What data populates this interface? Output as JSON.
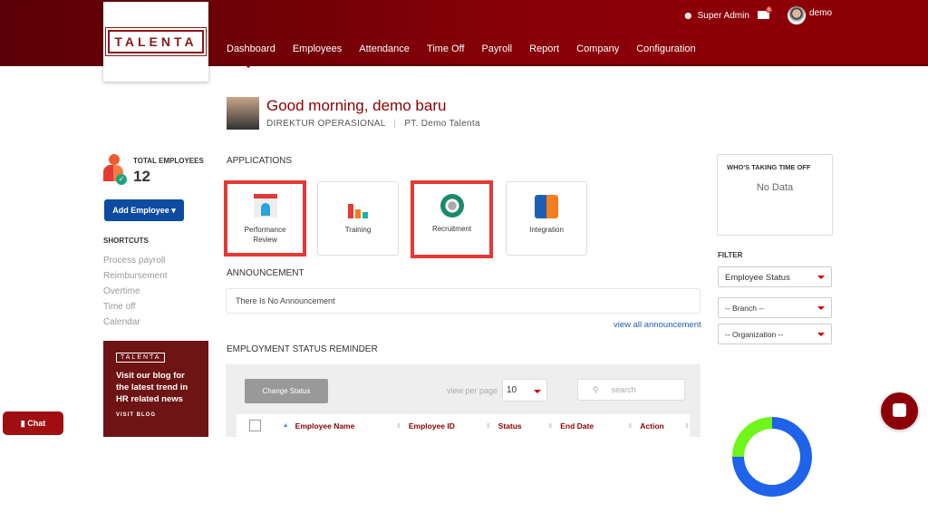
{
  "header": {
    "logo": "TALENTA",
    "nav": [
      "Dashboard",
      "Employees",
      "Attendance",
      "Time Off",
      "Payroll",
      "Report",
      "Company",
      "Configuration"
    ],
    "role": "Super Admin",
    "mail_badge": "6",
    "user": "demo"
  },
  "greeting": {
    "title": "Good morning, demo baru",
    "position": "DIREKTUR OPERASIONAL",
    "company": "PT. Demo Talenta"
  },
  "sidebar": {
    "total_label": "TOTAL EMPLOYEES",
    "total": "12",
    "add_button": "Add Employee",
    "shortcuts_title": "SHORTCUTS",
    "shortcuts": [
      "Process payroll",
      "Reimbursement",
      "Overtime",
      "Time off",
      "Calendar"
    ],
    "blog": {
      "logo": "TALENTA",
      "text": "Visit our blog for the latest trend in HR related news",
      "cta": "VISIT BLOG"
    },
    "chat": "Chat"
  },
  "applications": {
    "title": "APPLICATIONS",
    "items": [
      "Performance Review",
      "Training",
      "Recruitment",
      "Integration"
    ]
  },
  "announcement": {
    "title": "ANNOUNCEMENT",
    "empty": "There Is No Announcement",
    "link": "view all announcement"
  },
  "reminder": {
    "title": "EMPLOYMENT STATUS REMINDER",
    "change_status": "Change Status",
    "view_per_page_label": "view per page",
    "per_page": "10",
    "search_placeholder": "search",
    "columns": [
      "Employee Name",
      "Employee ID",
      "Status",
      "End Date",
      "Action"
    ]
  },
  "right": {
    "timeoff_title": "WHO'S TAKING TIME OFF",
    "timeoff_empty": "No Data",
    "filter_title": "FILTER",
    "filters": [
      "Employee Status",
      "-- Branch --",
      "-- Organization --"
    ]
  }
}
